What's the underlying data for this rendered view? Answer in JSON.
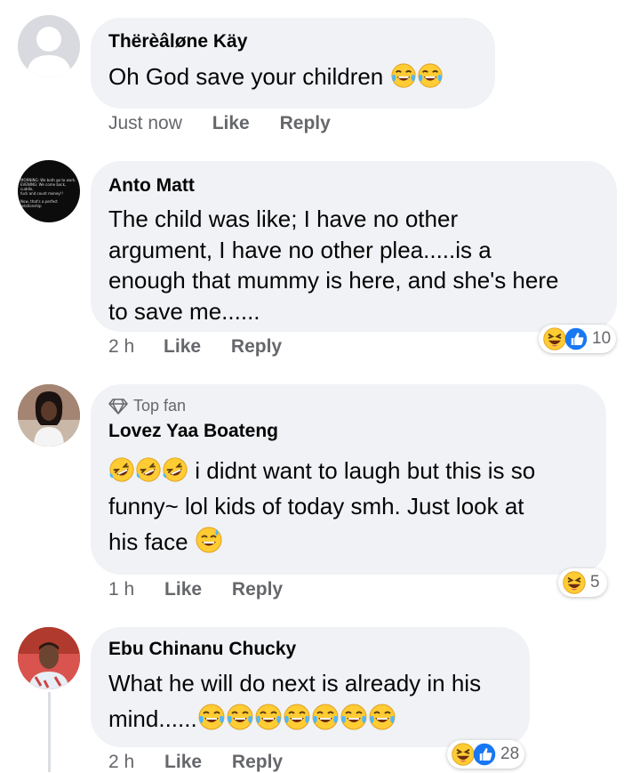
{
  "comments": [
    {
      "author": "Thërèâløne Käy",
      "text": "Oh God save your children",
      "emoji": [
        "face-with-tears-of-joy-icon",
        "face-with-tears-of-joy-icon"
      ],
      "time": "Just now",
      "like": "Like",
      "reply": "Reply"
    },
    {
      "author": "Anto Matt",
      "lines": [
        "The child was like; I have no other",
        "argument, I have no other plea.....is a",
        "enough that mummy is here, and she's here",
        "to save me......"
      ],
      "avatar_text": [
        "MORNING: We both go to work.",
        "EVENING: We come back, cuddle,",
        "fuck and count money!!",
        "Now, that's a perfect relationship"
      ],
      "time": "2 h",
      "like": "Like",
      "reply": "Reply",
      "reaction_count": "10",
      "reactions": [
        "laughing-face-icon",
        "like-thumb-icon"
      ]
    },
    {
      "badge": "Top fan",
      "author": "Lovez Yaa Boateng",
      "line1": "i didnt want to laugh but this is so",
      "line2": "funny~ lol kids of today smh. Just look at",
      "line3": "his face",
      "time": "1 h",
      "like": "Like",
      "reply": "Reply",
      "reaction_count": "5",
      "reactions": [
        "laughing-face-icon"
      ]
    },
    {
      "author": "Ebu Chinanu Chucky",
      "line1": "What he will do next is already in his",
      "line2": "mind......",
      "time": "2 h",
      "like": "Like",
      "reply": "Reply",
      "reaction_count": "28",
      "reactions": [
        "laughing-face-icon",
        "like-thumb-icon"
      ]
    }
  ]
}
